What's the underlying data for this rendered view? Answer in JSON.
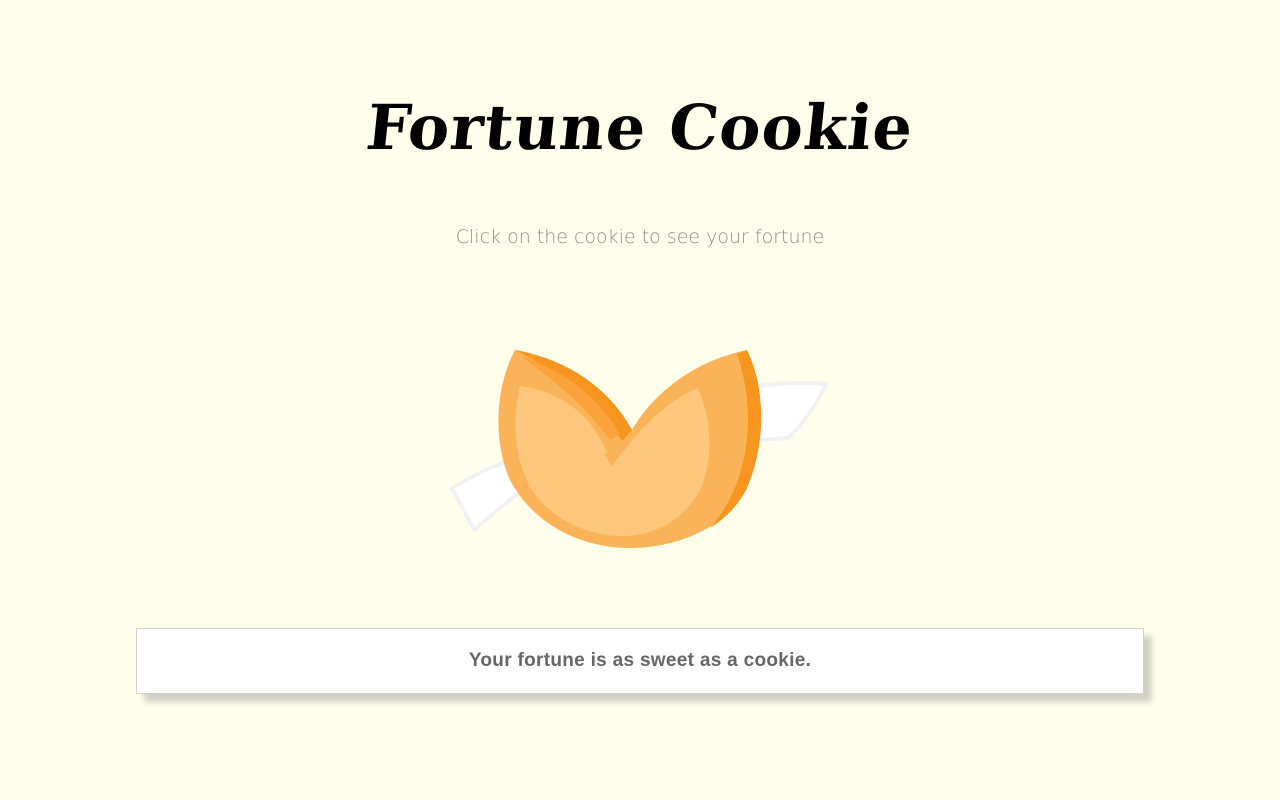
{
  "header": {
    "title": "Fortune Cookie",
    "subtitle": "Click on the cookie to see your fortune"
  },
  "cookie": {
    "icon": "fortune-cookie-icon",
    "colors": {
      "outer": "#fbb35a",
      "inner": "#fcc67c",
      "shade": "#f7951e",
      "paper": "#ffffff"
    }
  },
  "fortune": {
    "text": "Your fortune is as sweet as a cookie."
  },
  "theme": {
    "background": "#fffeeb",
    "title_color": "#000000",
    "subtitle_color": "#8d8d8d",
    "fortune_text_color": "#666666"
  }
}
